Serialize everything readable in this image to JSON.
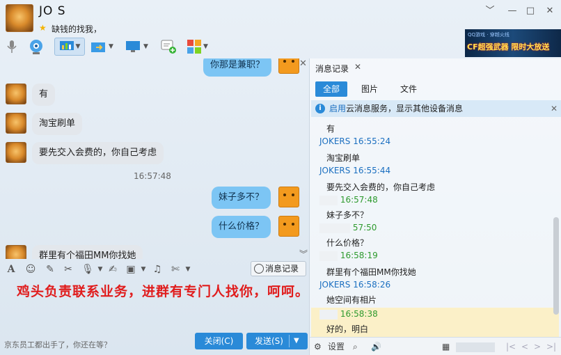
{
  "window": {
    "contact_name": "JO      S",
    "signature": "缺钱的找我，",
    "controls": [
      "﹀",
      "—",
      "□",
      "✕"
    ]
  },
  "ad_banner": {
    "top_text": "QQ游戏 · 穿越火线",
    "text": "CF超强武器 限时大放送"
  },
  "chat": {
    "messages": [
      {
        "side": "right",
        "text": "你那是兼职？"
      },
      {
        "side": "left",
        "text": "有"
      },
      {
        "side": "left",
        "text": "淘宝刷单"
      },
      {
        "side": "left",
        "text": "要先交入会费的，你自己考虑"
      },
      {
        "side": "right",
        "text": "妹子多不？"
      },
      {
        "side": "right",
        "text": "什么价格？"
      },
      {
        "side": "left",
        "text": "群里有个福田MM你找她"
      }
    ],
    "timestamp": "16:57:48"
  },
  "input": {
    "history_button": "消息记录",
    "text": "鸡头负责联系业务，进群有专门人找你，呵呵。",
    "bottom_ad": "京东员工都出手了，你还在等？",
    "close_button": "关闭(C)",
    "send_button": "发送(S)"
  },
  "history_panel": {
    "tab_label": "消息记录",
    "filters": [
      "全部",
      "图片",
      "文件"
    ],
    "notice_link": "启用",
    "notice_text": "云消息服务，显示其他设备消息",
    "rows": [
      {
        "kind": "text",
        "text": "有"
      },
      {
        "kind": "head",
        "sender": "JOKERS",
        "time": "16:55:24"
      },
      {
        "kind": "text",
        "text": "淘宝刷单"
      },
      {
        "kind": "head",
        "sender": "JOKERS",
        "time": "16:55:44"
      },
      {
        "kind": "text",
        "text": "要先交入会费的，你自己考虑"
      },
      {
        "kind": "head-me",
        "time": "16:57:48"
      },
      {
        "kind": "text",
        "text": "妹子多不？"
      },
      {
        "kind": "head-me",
        "time": "57:50"
      },
      {
        "kind": "text",
        "text": "什么价格？"
      },
      {
        "kind": "head-me",
        "time": "16:58:19"
      },
      {
        "kind": "text",
        "text": "群里有个福田MM你找她"
      },
      {
        "kind": "head",
        "sender": "JOKERS",
        "time": "16:58:26"
      },
      {
        "kind": "text",
        "text": "她空间有相片"
      },
      {
        "kind": "head-me",
        "time": "16:58:38"
      },
      {
        "kind": "text",
        "text": "好的，明白"
      }
    ],
    "bottom_settings": "设置"
  },
  "colors": {
    "accent": "#2a8ad8",
    "red_text": "#e01c1c",
    "link": "#1b6fc0",
    "me_green": "#2e9a2e"
  }
}
